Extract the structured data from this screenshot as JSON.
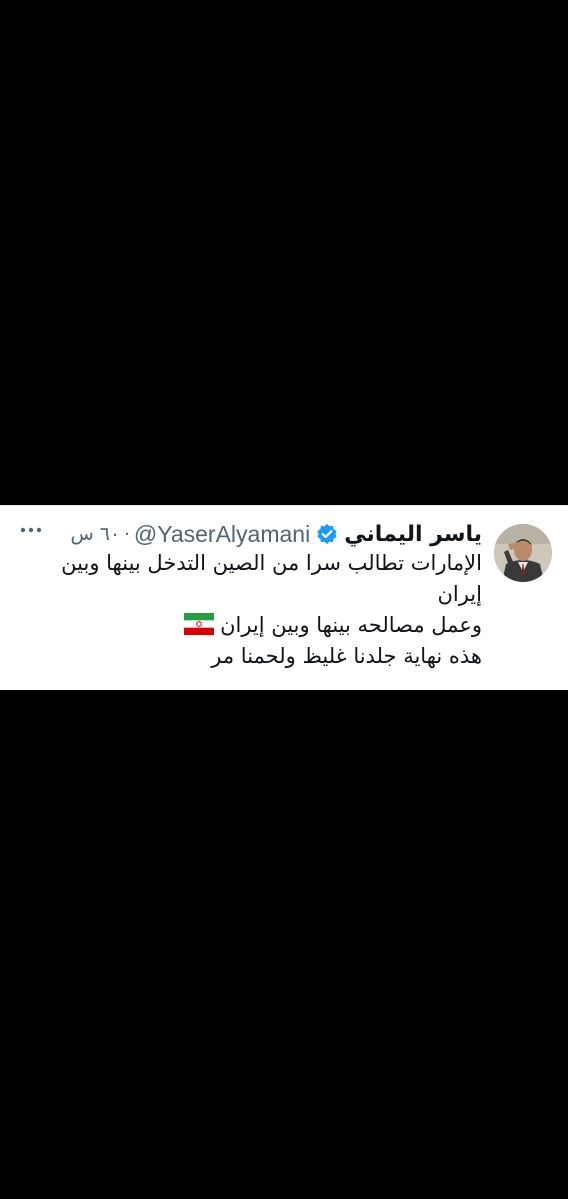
{
  "tweet": {
    "display_name": "ياسر اليماني",
    "handle": "@YaserAlyamani",
    "separator": "·",
    "timestamp": "٦٠ س",
    "verified_icon": "verified-badge-icon",
    "lines": [
      "الإمارات تطالب سرا من الصين التدخل بينها وبين",
      "إيران",
      "وعمل مصالحه بينها وبين إيران",
      "هذه نهاية جلدنا غليظ ولحمنا مر"
    ],
    "flag_icon": "iran-flag-icon",
    "more_icon": "more-options-icon"
  },
  "colors": {
    "background": "#000000",
    "card": "#ffffff",
    "text_primary": "#0f1419",
    "text_secondary": "#536471",
    "verified_blue": "#1d9bf0"
  }
}
